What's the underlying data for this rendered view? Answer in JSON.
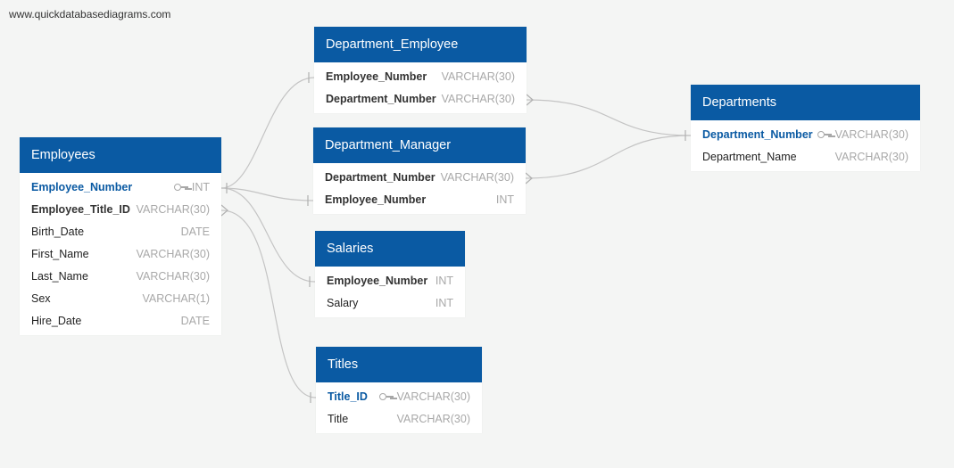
{
  "watermark": "www.quickdatabasediagrams.com",
  "colors": {
    "header": "#0a5aa3",
    "primary_key": "#0a5aa3",
    "type": "#a8a8a8",
    "connector": "#c4c4c4"
  },
  "tables": {
    "employees": {
      "title": "Employees",
      "fields": [
        {
          "name": "Employee_Number",
          "type": "INT",
          "pk": true
        },
        {
          "name": "Employee_Title_ID",
          "type": "VARCHAR(30)",
          "fk": true
        },
        {
          "name": "Birth_Date",
          "type": "DATE"
        },
        {
          "name": "First_Name",
          "type": "VARCHAR(30)"
        },
        {
          "name": "Last_Name",
          "type": "VARCHAR(30)"
        },
        {
          "name": "Sex",
          "type": "VARCHAR(1)"
        },
        {
          "name": "Hire_Date",
          "type": "DATE"
        }
      ]
    },
    "department_employee": {
      "title": "Department_Employee",
      "fields": [
        {
          "name": "Employee_Number",
          "type": "VARCHAR(30)",
          "fk": true
        },
        {
          "name": "Department_Number",
          "type": "VARCHAR(30)",
          "fk": true
        }
      ]
    },
    "department_manager": {
      "title": "Department_Manager",
      "fields": [
        {
          "name": "Department_Number",
          "type": "VARCHAR(30)",
          "fk": true
        },
        {
          "name": "Employee_Number",
          "type": "INT",
          "fk": true
        }
      ]
    },
    "salaries": {
      "title": "Salaries",
      "fields": [
        {
          "name": "Employee_Number",
          "type": "INT",
          "fk": true
        },
        {
          "name": "Salary",
          "type": "INT"
        }
      ]
    },
    "titles": {
      "title": "Titles",
      "fields": [
        {
          "name": "Title_ID",
          "type": "VARCHAR(30)",
          "pk": true
        },
        {
          "name": "Title",
          "type": "VARCHAR(30)"
        }
      ]
    },
    "departments": {
      "title": "Departments",
      "fields": [
        {
          "name": "Department_Number",
          "type": "VARCHAR(30)",
          "pk": true
        },
        {
          "name": "Department_Name",
          "type": "VARCHAR(30)"
        }
      ]
    }
  }
}
